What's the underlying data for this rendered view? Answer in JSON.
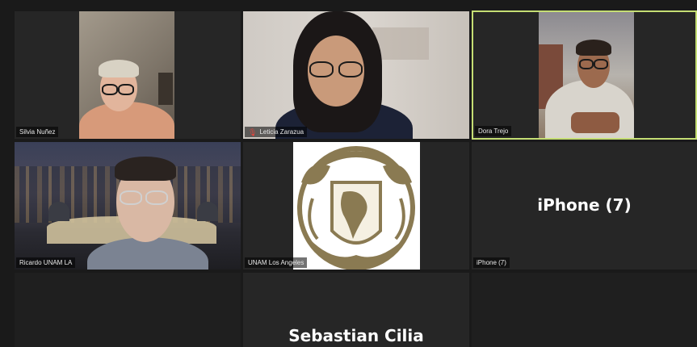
{
  "participants": [
    {
      "name": "Silvia Nuñez"
    },
    {
      "name": "Leticia Zarazua",
      "muted": true
    },
    {
      "name": "Dora Trejo",
      "active_speaker": true
    },
    {
      "name": "Ricardo UNAM LA"
    },
    {
      "name": "UNAM Los Angeles"
    },
    {
      "name": "iPhone (7)",
      "display_name": "iPhone (7)"
    },
    {
      "name": "Sebastian Cilia",
      "display_name": "Sebastian Cilia"
    }
  ],
  "colors": {
    "active_border": "#c5de74",
    "muted_icon": "#e0473d",
    "tile_bg": "#262626",
    "background": "#1a1a1a"
  },
  "icons": {
    "muted": "mic-muted-icon"
  }
}
